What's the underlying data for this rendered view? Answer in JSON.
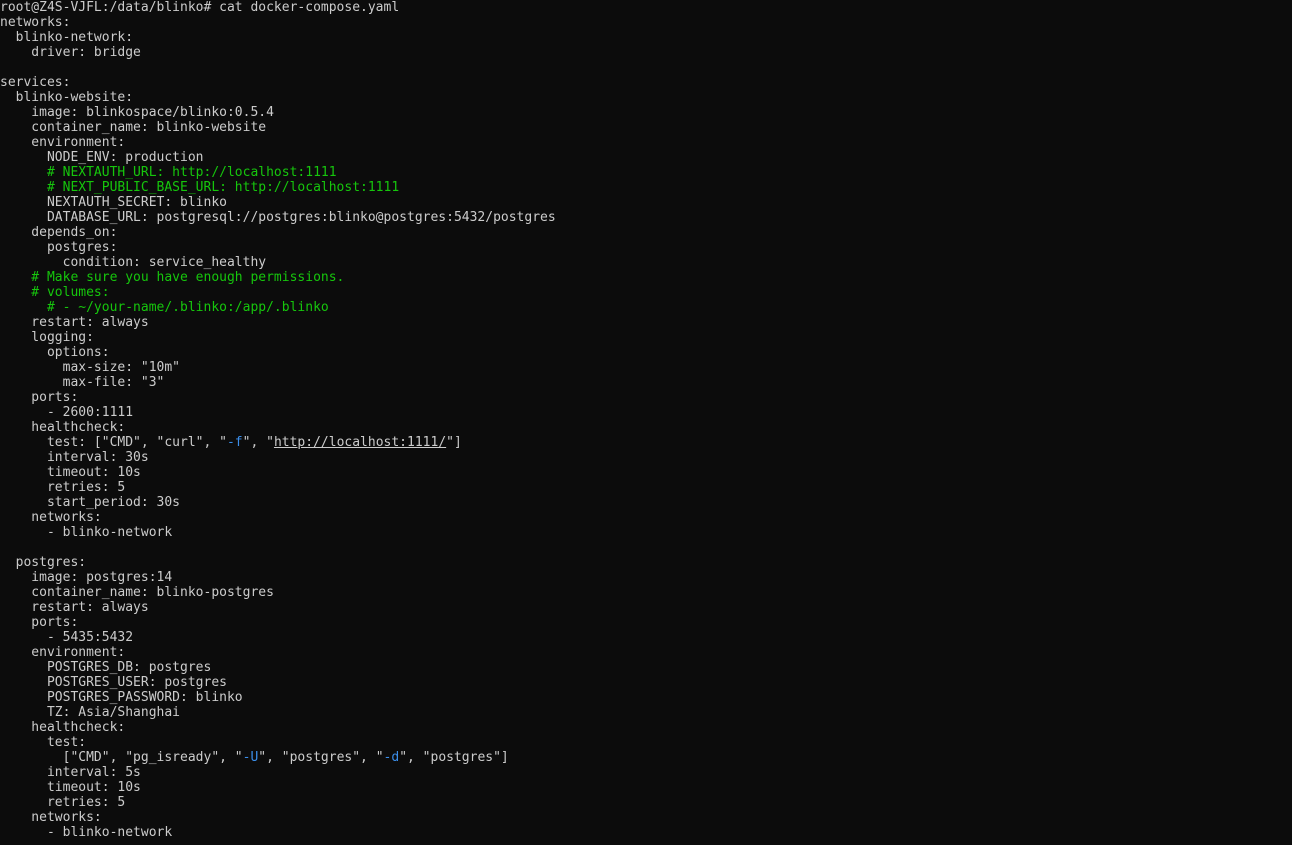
{
  "terminal": {
    "colors": {
      "background": "#0c0c0c",
      "foreground": "#cccccc",
      "comment": "#16c60c",
      "flag": "#3b8eea"
    },
    "lines": [
      [
        {
          "t": "root@Z4S-VJFL:/data/blinko# cat docker-compose.yaml"
        }
      ],
      [
        {
          "t": "networks:"
        }
      ],
      [
        {
          "t": "  blinko-network:"
        }
      ],
      [
        {
          "t": "    driver: bridge"
        }
      ],
      [
        {
          "t": ""
        }
      ],
      [
        {
          "t": "services:"
        }
      ],
      [
        {
          "t": "  blinko-website:"
        }
      ],
      [
        {
          "t": "    image: blinkospace/blinko:0.5.4"
        }
      ],
      [
        {
          "t": "    container_name: blinko-website"
        }
      ],
      [
        {
          "t": "    environment:"
        }
      ],
      [
        {
          "t": "      NODE_ENV: production"
        }
      ],
      [
        {
          "t": "      # NEXTAUTH_URL: http://localhost:1111",
          "c": "comment"
        }
      ],
      [
        {
          "t": "      # NEXT_PUBLIC_BASE_URL: http://localhost:1111",
          "c": "comment"
        }
      ],
      [
        {
          "t": "      NEXTAUTH_SECRET: blinko"
        }
      ],
      [
        {
          "t": "      DATABASE_URL: postgresql://postgres:blinko@postgres:5432/postgres"
        }
      ],
      [
        {
          "t": "    depends_on:"
        }
      ],
      [
        {
          "t": "      postgres:"
        }
      ],
      [
        {
          "t": "        condition: service_healthy"
        }
      ],
      [
        {
          "t": "    # Make sure you have enough permissions.",
          "c": "comment"
        }
      ],
      [
        {
          "t": "    # volumes:",
          "c": "comment"
        }
      ],
      [
        {
          "t": "      # - ~/your-name/.blinko:/app/.blinko",
          "c": "comment"
        }
      ],
      [
        {
          "t": "    restart: always"
        }
      ],
      [
        {
          "t": "    logging:"
        }
      ],
      [
        {
          "t": "      options:"
        }
      ],
      [
        {
          "t": "        max-size: \"10m\""
        }
      ],
      [
        {
          "t": "        max-file: \"3\""
        }
      ],
      [
        {
          "t": "    ports:"
        }
      ],
      [
        {
          "t": "      - 2600:1111"
        }
      ],
      [
        {
          "t": "    healthcheck:"
        }
      ],
      [
        {
          "t": "      test: [\"CMD\", \"curl\", \""
        },
        {
          "t": "-f",
          "c": "flag"
        },
        {
          "t": "\", \""
        },
        {
          "t": "http://localhost:1111/",
          "c": "url"
        },
        {
          "t": "\"]"
        }
      ],
      [
        {
          "t": "      interval: 30s"
        }
      ],
      [
        {
          "t": "      timeout: 10s"
        }
      ],
      [
        {
          "t": "      retries: 5"
        }
      ],
      [
        {
          "t": "      start_period: 30s"
        }
      ],
      [
        {
          "t": "    networks:"
        }
      ],
      [
        {
          "t": "      - blinko-network"
        }
      ],
      [
        {
          "t": ""
        }
      ],
      [
        {
          "t": "  postgres:"
        }
      ],
      [
        {
          "t": "    image: postgres:14"
        }
      ],
      [
        {
          "t": "    container_name: blinko-postgres"
        }
      ],
      [
        {
          "t": "    restart: always"
        }
      ],
      [
        {
          "t": "    ports:"
        }
      ],
      [
        {
          "t": "      - 5435:5432"
        }
      ],
      [
        {
          "t": "    environment:"
        }
      ],
      [
        {
          "t": "      POSTGRES_DB: postgres"
        }
      ],
      [
        {
          "t": "      POSTGRES_USER: postgres"
        }
      ],
      [
        {
          "t": "      POSTGRES_PASSWORD: blinko"
        }
      ],
      [
        {
          "t": "      TZ: Asia/Shanghai"
        }
      ],
      [
        {
          "t": "    healthcheck:"
        }
      ],
      [
        {
          "t": "      test:"
        }
      ],
      [
        {
          "t": "        [\"CMD\", \"pg_isready\", \""
        },
        {
          "t": "-U",
          "c": "flag"
        },
        {
          "t": "\", \"postgres\", \""
        },
        {
          "t": "-d",
          "c": "flag"
        },
        {
          "t": "\", \"postgres\"]"
        }
      ],
      [
        {
          "t": "      interval: 5s"
        }
      ],
      [
        {
          "t": "      timeout: 10s"
        }
      ],
      [
        {
          "t": "      retries: 5"
        }
      ],
      [
        {
          "t": "    networks:"
        }
      ],
      [
        {
          "t": "      - blinko-network"
        }
      ]
    ]
  }
}
